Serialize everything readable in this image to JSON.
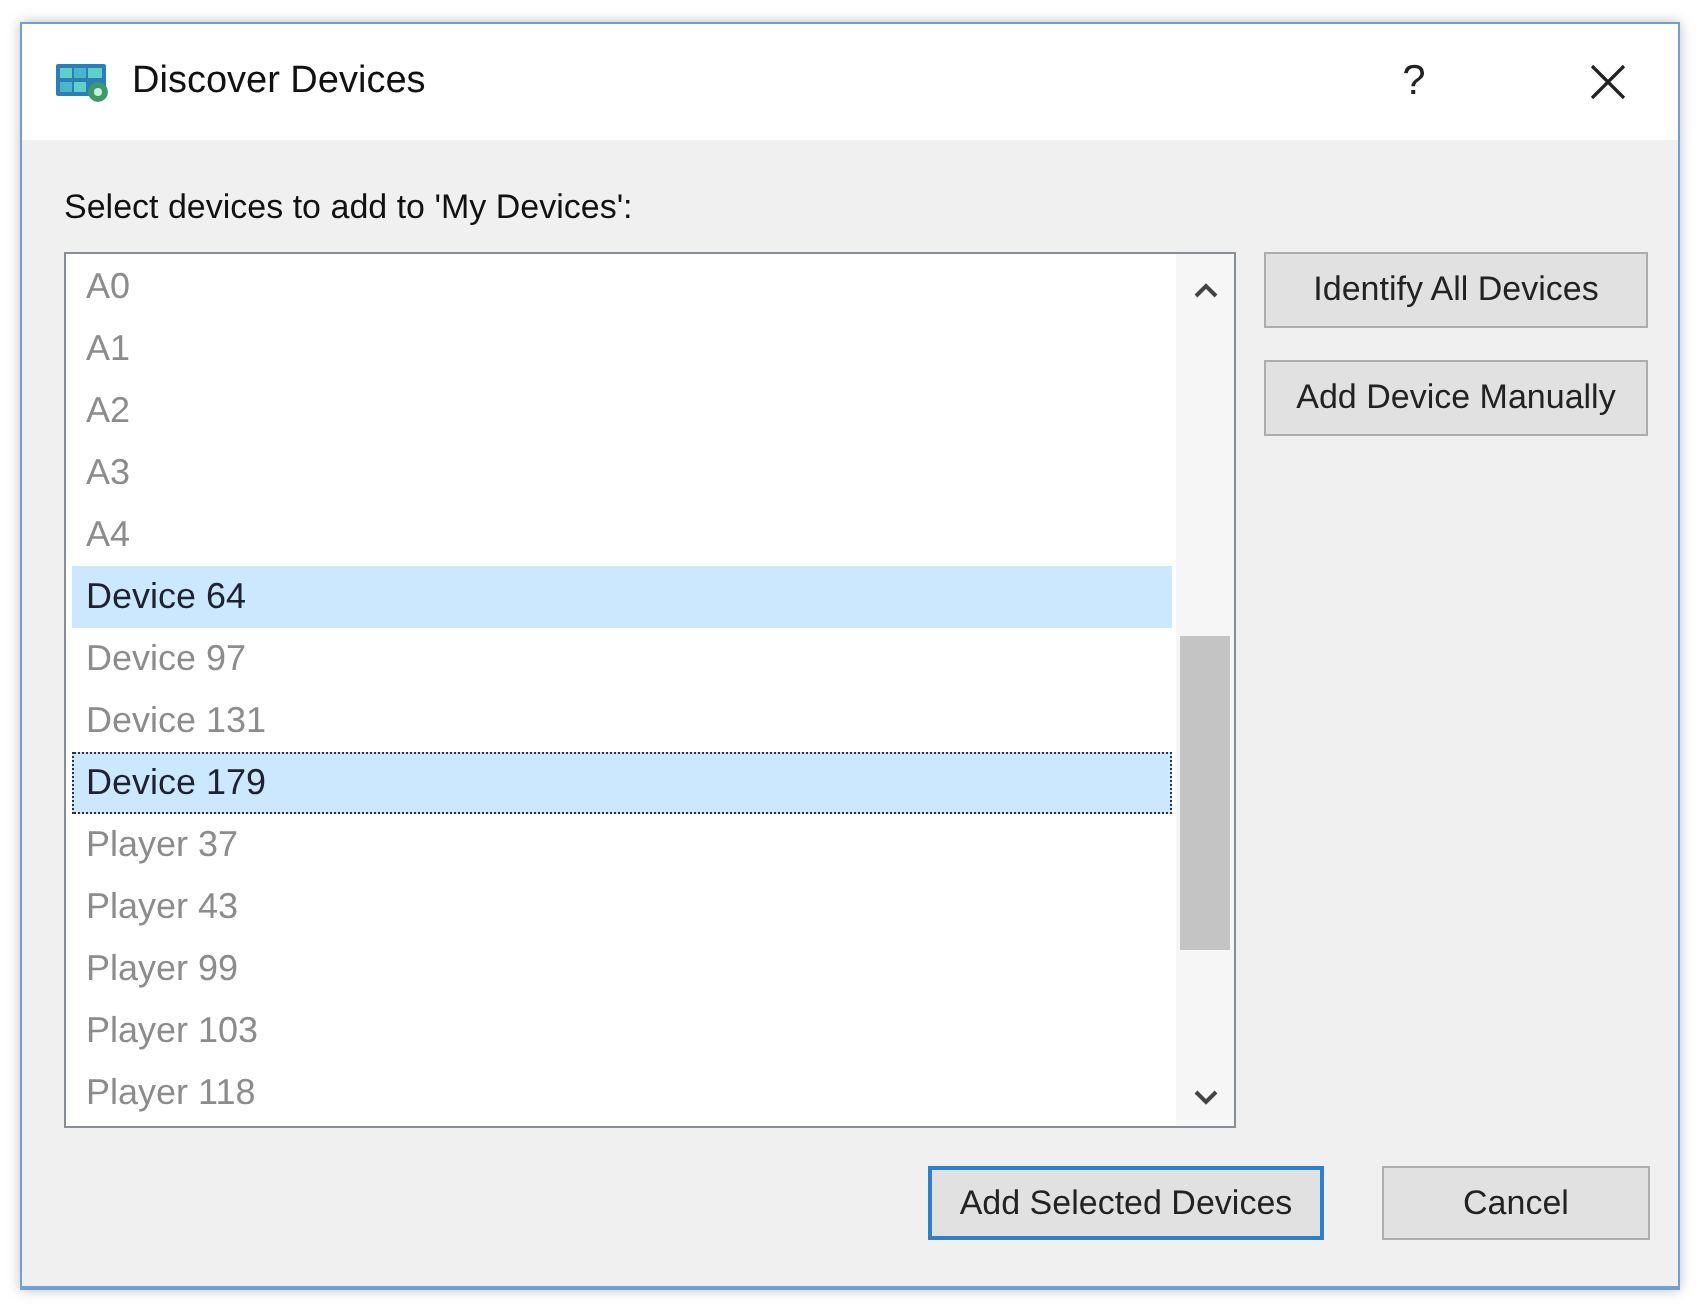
{
  "window": {
    "title": "Discover Devices",
    "help": "?"
  },
  "prompt": "Select devices to add to 'My Devices':",
  "devices": [
    {
      "name": "A0",
      "selected": false,
      "focused": false
    },
    {
      "name": "A1",
      "selected": false,
      "focused": false
    },
    {
      "name": "A2",
      "selected": false,
      "focused": false
    },
    {
      "name": "A3",
      "selected": false,
      "focused": false
    },
    {
      "name": "A4",
      "selected": false,
      "focused": false
    },
    {
      "name": "Device 64",
      "selected": true,
      "focused": false
    },
    {
      "name": "Device 97",
      "selected": false,
      "focused": false
    },
    {
      "name": "Device 131",
      "selected": false,
      "focused": false
    },
    {
      "name": "Device 179",
      "selected": true,
      "focused": true
    },
    {
      "name": "Player 37",
      "selected": false,
      "focused": false
    },
    {
      "name": "Player 43",
      "selected": false,
      "focused": false
    },
    {
      "name": "Player 99",
      "selected": false,
      "focused": false
    },
    {
      "name": "Player 103",
      "selected": false,
      "focused": false
    },
    {
      "name": "Player 118",
      "selected": false,
      "focused": false
    }
  ],
  "side_buttons": [
    {
      "label": "Identify All Devices"
    },
    {
      "label": "Add Device Manually"
    }
  ],
  "footer_buttons": [
    {
      "label": "Add Selected Devices",
      "default": true
    },
    {
      "label": "Cancel",
      "default": false
    }
  ]
}
